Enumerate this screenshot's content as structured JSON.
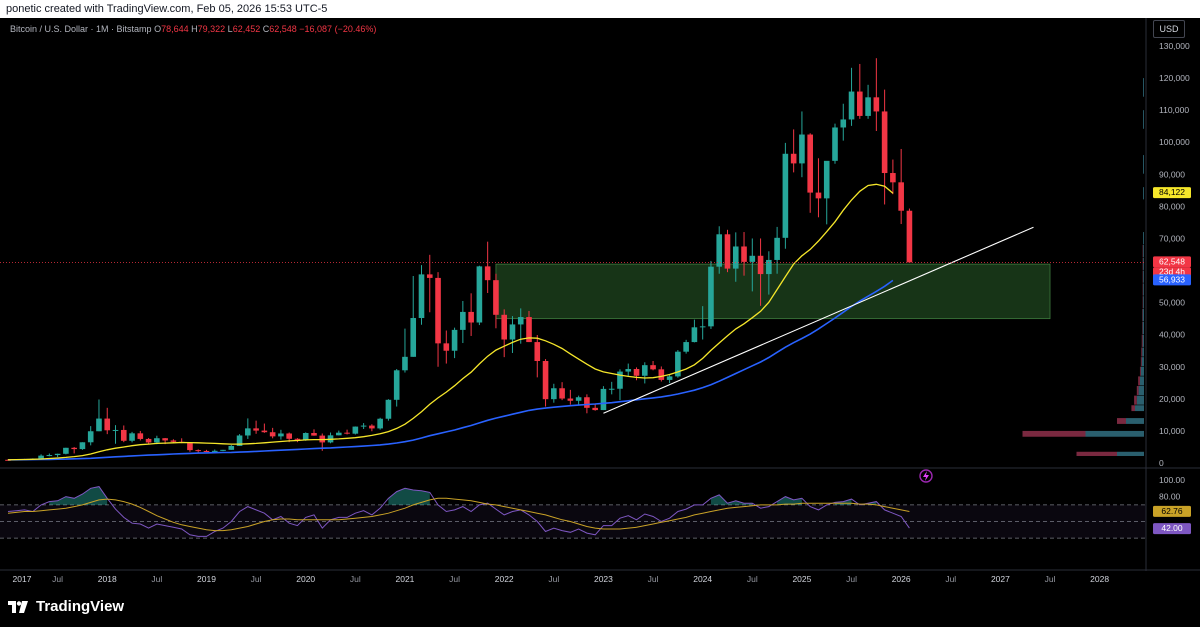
{
  "header": {
    "attribution": "ponetic created with TradingView.com, Feb 05, 2026 15:53 UTC-5"
  },
  "legend": {
    "symbol": "Bitcoin / U.S. Dollar · 1M · Bitstamp",
    "o_label": "O",
    "o_value": "78,644",
    "h_label": "H",
    "h_value": "79,322",
    "l_label": "L",
    "l_value": "62,452",
    "c_label": "C",
    "c_value": "62,548",
    "change": "−16,087 (−20.46%)"
  },
  "currency_button": "USD",
  "brand": {
    "name": "TradingView"
  },
  "colors": {
    "up": "#26a69a",
    "down": "#f23645",
    "ma_fast": "#f5e62a",
    "ma_slow": "#2962ff",
    "trendline": "#ffffff",
    "zone": "#1b3d1b",
    "rsi": "#7e57c2",
    "rsi_ma": "#c9a227",
    "profile_up": "#2a5f6e",
    "profile_down": "#7a2940"
  },
  "chart_data": {
    "type": "candlestick",
    "timeframe": "1M",
    "ylim": [
      0,
      130000
    ],
    "x_labels": [
      "2017",
      "Jul",
      "2018",
      "Jul",
      "2019",
      "Jul",
      "2020",
      "Jul",
      "2021",
      "Jul",
      "2022",
      "Jul",
      "2023",
      "Jul",
      "2024",
      "Jul",
      "2025",
      "Jul",
      "2026",
      "Jul",
      "2027",
      "Jul",
      "2028"
    ],
    "y_ticks": [
      "130,000",
      "120,000",
      "110,000",
      "100,000",
      "90,000",
      "80,000",
      "70,000",
      "60,000",
      "50,000",
      "40,000",
      "30,000",
      "20,000",
      "10,000",
      "0"
    ],
    "price_labels": {
      "ma_fast": "84,122",
      "last": "62,548",
      "countdown": "23d 4h",
      "ma_slow": "56,933"
    },
    "rsi": {
      "ticks": [
        "100.00",
        "80.00"
      ],
      "rsi_ma_label": "62.76",
      "rsi_label": "42.00",
      "levels": [
        70,
        50,
        30
      ]
    },
    "ohlc": [
      [
        998,
        1200,
        980,
        970
      ],
      [
        970,
        1250,
        950,
        1190
      ],
      [
        1190,
        1290,
        1000,
        1080
      ],
      [
        1080,
        1450,
        1080,
        1350
      ],
      [
        1350,
        2700,
        1340,
        2300
      ],
      [
        2300,
        2950,
        2100,
        2480
      ],
      [
        2480,
        2900,
        1850,
        2870
      ],
      [
        2870,
        4750,
        2700,
        4740
      ],
      [
        4740,
        5000,
        2980,
        4340
      ],
      [
        4340,
        6470,
        4100,
        6460
      ],
      [
        6460,
        11500,
        5500,
        9900
      ],
      [
        9900,
        19800,
        9900,
        13850
      ],
      [
        13850,
        17200,
        9000,
        10200
      ],
      [
        10200,
        11800,
        6000,
        10300
      ],
      [
        10300,
        11700,
        6500,
        6930
      ],
      [
        6930,
        9700,
        6430,
        9250
      ],
      [
        9250,
        9990,
        7030,
        7500
      ],
      [
        7500,
        7800,
        5800,
        6400
      ],
      [
        6400,
        8500,
        5860,
        7730
      ],
      [
        7730,
        7800,
        5880,
        7030
      ],
      [
        7030,
        7400,
        6100,
        6600
      ],
      [
        6600,
        7700,
        6200,
        6300
      ],
      [
        6300,
        6500,
        3500,
        4020
      ],
      [
        4020,
        4250,
        3200,
        3750
      ],
      [
        3750,
        4100,
        3400,
        3460
      ],
      [
        3460,
        4200,
        3400,
        3800
      ],
      [
        3800,
        4100,
        3700,
        4100
      ],
      [
        4100,
        5600,
        4100,
        5320
      ],
      [
        5320,
        9000,
        5300,
        8580
      ],
      [
        8580,
        13900,
        7500,
        10800
      ],
      [
        10800,
        13200,
        9100,
        10100
      ],
      [
        10100,
        12300,
        9400,
        9600
      ],
      [
        9600,
        10950,
        7700,
        8300
      ],
      [
        8300,
        10350,
        7300,
        9200
      ],
      [
        9200,
        9500,
        6500,
        7550
      ],
      [
        7550,
        7750,
        6500,
        7200
      ],
      [
        7200,
        9550,
        6900,
        9350
      ],
      [
        9350,
        10500,
        8500,
        8540
      ],
      [
        8540,
        9200,
        3800,
        6420
      ],
      [
        6420,
        9500,
        6150,
        8630
      ],
      [
        8630,
        10100,
        8600,
        9450
      ],
      [
        9450,
        10400,
        8900,
        9140
      ],
      [
        9140,
        11400,
        8900,
        11350
      ],
      [
        11350,
        12450,
        10600,
        11660
      ],
      [
        11660,
        12080,
        9900,
        10780
      ],
      [
        10780,
        14100,
        10400,
        13800
      ],
      [
        13800,
        19900,
        13200,
        19700
      ],
      [
        19700,
        29300,
        17600,
        28900
      ],
      [
        28900,
        41900,
        28200,
        33100
      ],
      [
        33100,
        58300,
        33100,
        45200
      ],
      [
        45200,
        61700,
        43100,
        58800
      ],
      [
        58800,
        64900,
        47000,
        57700
      ],
      [
        57700,
        59500,
        30000,
        37300
      ],
      [
        37300,
        41300,
        31000,
        35000
      ],
      [
        35000,
        42200,
        32700,
        41500
      ],
      [
        41500,
        50500,
        37400,
        47100
      ],
      [
        47100,
        52900,
        39600,
        43800
      ],
      [
        43800,
        61500,
        43000,
        61300
      ],
      [
        61300,
        69000,
        53000,
        57000
      ],
      [
        57000,
        59000,
        42000,
        46200
      ],
      [
        46200,
        47900,
        33000,
        38500
      ],
      [
        38500,
        45800,
        34300,
        43200
      ],
      [
        43200,
        48200,
        37200,
        45500
      ],
      [
        45500,
        47400,
        37700,
        37700
      ],
      [
        37700,
        39900,
        26700,
        31800
      ],
      [
        31800,
        32400,
        17600,
        19900
      ],
      [
        19900,
        24700,
        18800,
        23300
      ],
      [
        23300,
        25200,
        19600,
        20100
      ],
      [
        20100,
        22800,
        18200,
        19400
      ],
      [
        19400,
        21000,
        18200,
        20500
      ],
      [
        20500,
        21400,
        15500,
        17200
      ],
      [
        17200,
        18300,
        16300,
        16500
      ],
      [
        16500,
        23950,
        16500,
        23100
      ],
      [
        23100,
        25300,
        21400,
        23150
      ],
      [
        23150,
        29200,
        19600,
        28500
      ],
      [
        28500,
        31000,
        26900,
        29300
      ],
      [
        29300,
        29800,
        25800,
        27200
      ],
      [
        27200,
        31400,
        24800,
        30500
      ],
      [
        30500,
        31800,
        28900,
        29200
      ],
      [
        29200,
        30100,
        25400,
        25900
      ],
      [
        25900,
        27500,
        24900,
        27000
      ],
      [
        27000,
        35200,
        26600,
        34700
      ],
      [
        34700,
        38400,
        34100,
        37700
      ],
      [
        37700,
        44700,
        37600,
        42300
      ],
      [
        42300,
        48900,
        38500,
        42600
      ],
      [
        42600,
        63000,
        41800,
        61200
      ],
      [
        61200,
        73800,
        59000,
        71300
      ],
      [
        71300,
        72700,
        59500,
        60600
      ],
      [
        60600,
        71900,
        56500,
        67500
      ],
      [
        67500,
        72000,
        58400,
        62700
      ],
      [
        62700,
        70000,
        53500,
        64600
      ],
      [
        64600,
        70000,
        49000,
        58900
      ],
      [
        58900,
        66000,
        52500,
        63300
      ],
      [
        63300,
        73600,
        59000,
        70200
      ],
      [
        70200,
        99800,
        66800,
        96400
      ],
      [
        96400,
        104000,
        90600,
        93400
      ],
      [
        93400,
        109600,
        89100,
        102400
      ],
      [
        102400,
        102800,
        78000,
        84300
      ],
      [
        84300,
        95000,
        76600,
        82500
      ],
      [
        82500,
        88500,
        74400,
        94200
      ],
      [
        94200,
        105800,
        93300,
        104600
      ],
      [
        104600,
        112000,
        100500,
        107100
      ],
      [
        107100,
        123200,
        105100,
        115800
      ],
      [
        115800,
        124400,
        107300,
        108200
      ],
      [
        108200,
        117900,
        107300,
        114000
      ],
      [
        114000,
        126200,
        103500,
        109600
      ],
      [
        109600,
        116400,
        80600,
        90400
      ],
      [
        90400,
        94600,
        83800,
        87500
      ],
      [
        87500,
        97900,
        74500,
        78644
      ],
      [
        78644,
        79322,
        62452,
        62548
      ]
    ],
    "ma_fast_values": [
      1000,
      1050,
      1100,
      1150,
      1250,
      1400,
      1550,
      1750,
      2000,
      2300,
      2800,
      3500,
      4100,
      4600,
      5000,
      5400,
      5700,
      5900,
      6100,
      6200,
      6300,
      6400,
      6350,
      6300,
      6200,
      6100,
      6000,
      5900,
      5900,
      6000,
      6100,
      6300,
      6500,
      6700,
      6900,
      7000,
      7200,
      7300,
      7300,
      7400,
      7500,
      7700,
      7900,
      8200,
      8600,
      9100,
      9800,
      10800,
      12100,
      13900,
      16000,
      18300,
      20300,
      22100,
      24100,
      26300,
      28300,
      30900,
      33300,
      35200,
      36400,
      37600,
      38600,
      39000,
      38900,
      38100,
      37000,
      35700,
      34000,
      32400,
      30800,
      29300,
      28400,
      27900,
      27400,
      27000,
      26700,
      26500,
      26600,
      27000,
      27600,
      28400,
      29300,
      30600,
      32600,
      35100,
      37400,
      39700,
      41800,
      43400,
      45300,
      47300,
      50100,
      54100,
      58100,
      62000,
      64600,
      66600,
      69200,
      72100,
      75200,
      78800,
      82000,
      84700,
      86500,
      86900,
      86300,
      84100
    ],
    "ma_slow_values": [
      1000,
      1010,
      1030,
      1050,
      1080,
      1120,
      1170,
      1230,
      1300,
      1380,
      1480,
      1620,
      1770,
      1920,
      2060,
      2200,
      2330,
      2450,
      2570,
      2690,
      2800,
      2910,
      3000,
      3080,
      3140,
      3200,
      3260,
      3320,
      3400,
      3500,
      3620,
      3740,
      3870,
      4000,
      4120,
      4250,
      4380,
      4500,
      4600,
      4720,
      4850,
      4980,
      5120,
      5280,
      5450,
      5650,
      5900,
      6250,
      6650,
      7150,
      7800,
      8500,
      9100,
      9700,
      10300,
      11000,
      11700,
      12500,
      13300,
      14000,
      14600,
      15200,
      15800,
      16400,
      16800,
      17100,
      17400,
      17650,
      17850,
      18050,
      18250,
      18400,
      18600,
      18800,
      19100,
      19400,
      19700,
      20000,
      20300,
      20600,
      21000,
      21500,
      22100,
      22700,
      23500,
      24400,
      25500,
      26700,
      27900,
      29100,
      30300,
      31500,
      32900,
      34500,
      36100,
      37500,
      38800,
      40200,
      41800,
      43500,
      45200,
      47000,
      48800,
      50500,
      52000,
      53500,
      55100,
      56933
    ],
    "trendline": {
      "from": {
        "index": 72,
        "price": 15500
      },
      "to": {
        "index": 124,
        "price": 73500
      }
    },
    "support_zone": {
      "low": 45000,
      "high": 62000
    },
    "rsi_values": [
      62,
      63,
      64,
      62,
      70,
      74,
      75,
      80,
      78,
      83,
      90,
      92,
      78,
      65,
      55,
      48,
      47,
      42,
      47,
      45,
      43,
      41,
      34,
      32,
      32,
      38,
      42,
      50,
      62,
      68,
      64,
      60,
      52,
      56,
      48,
      45,
      55,
      58,
      42,
      52,
      55,
      55,
      60,
      63,
      58,
      66,
      78,
      86,
      90,
      88,
      87,
      85,
      70,
      62,
      64,
      68,
      62,
      70,
      72,
      65,
      58,
      62,
      64,
      58,
      50,
      38,
      42,
      39,
      37,
      41,
      36,
      34,
      45,
      45,
      54,
      57,
      52,
      59,
      56,
      50,
      54,
      62,
      65,
      70,
      70,
      78,
      82,
      72,
      75,
      72,
      72,
      66,
      68,
      74,
      80,
      76,
      78,
      68,
      64,
      70,
      73,
      74,
      77,
      70,
      72,
      74,
      64,
      60,
      56,
      42
    ],
    "rsi_ma_values": [
      60,
      61,
      62,
      62,
      63,
      64,
      65,
      66,
      68,
      70,
      73,
      76,
      77,
      76,
      74,
      71,
      67,
      62,
      57,
      53,
      49,
      46,
      44,
      42,
      40,
      39,
      39,
      40,
      42,
      44,
      47,
      50,
      52,
      53,
      53,
      52,
      52,
      52,
      52,
      52,
      52,
      53,
      54,
      55,
      56,
      58,
      60,
      63,
      66,
      70,
      73,
      76,
      78,
      78,
      77,
      76,
      75,
      73,
      71,
      70,
      68,
      66,
      64,
      62,
      60,
      58,
      55,
      52,
      50,
      47,
      44,
      42,
      41,
      41,
      41,
      42,
      43,
      45,
      47,
      49,
      51,
      53,
      55,
      58,
      60,
      62,
      64,
      66,
      67,
      68,
      69,
      70,
      70,
      70,
      71,
      71,
      72,
      72,
      72,
      72,
      72,
      72,
      72,
      71,
      71,
      70,
      68,
      66,
      64,
      62
    ]
  }
}
